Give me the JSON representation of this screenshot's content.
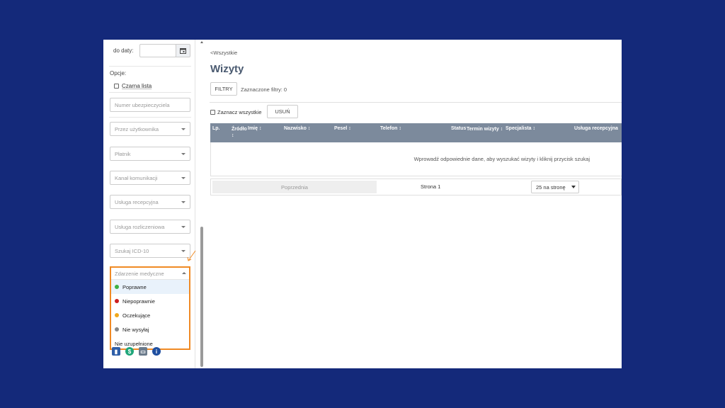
{
  "sidebar": {
    "date_to_label": "do daty:",
    "options_label": "Opcje:",
    "blacklist_label": "Czarna lista",
    "fields": [
      {
        "placeholder": "Numer ubezpieczyciela"
      },
      {
        "placeholder": "Przez użytkownika"
      },
      {
        "placeholder": "Płatnik"
      },
      {
        "placeholder": "Kanał komunikacji"
      },
      {
        "placeholder": "Usługa recepcyjna"
      },
      {
        "placeholder": "Usługa rozliczeniowa"
      },
      {
        "placeholder": "Szukaj ICD-10"
      }
    ],
    "medical_event": {
      "placeholder": "Zdarzenie medyczne",
      "options": [
        {
          "label": "Poprawne",
          "color": "#3cb043"
        },
        {
          "label": "Niepoprawnie",
          "color": "#cc1f1f"
        },
        {
          "label": "Oczekujące",
          "color": "#f0a81c"
        },
        {
          "label": "Nie wysyłaj",
          "color": "#888888"
        },
        {
          "label": "Nie uzupełnione",
          "color": ""
        }
      ]
    },
    "bottom_icons": [
      "book-icon",
      "dollar-icon",
      "monitor-icon",
      "info-icon"
    ]
  },
  "main": {
    "breadcrumb": "<Wszystkie",
    "title": "Wizyty",
    "filters_button": "FILTRY",
    "selected_filters": "Zaznaczone filtry: 0",
    "select_all": "Zaznacz wszystkie",
    "delete_button": "USUŃ",
    "columns": [
      "Lp.",
      "Źródło ↕",
      "Imię ↕",
      "Nazwisko ↕",
      "Pesel ↕",
      "Telefon ↕",
      "Status",
      "Termin wizyty ↕",
      "Specjalista ↕",
      "Usługa recepcyjna"
    ],
    "empty_message": "Wprowadź odpowiednie dane, aby wyszukać wizyty i kliknij przycisk szukaj",
    "pager": {
      "previous": "Poprzednia",
      "page": "Strona 1",
      "per_page": "25 na stronę"
    }
  },
  "colors": {
    "background": "#14297a",
    "highlight": "#f08a24",
    "table_header": "#7c8a9c"
  }
}
